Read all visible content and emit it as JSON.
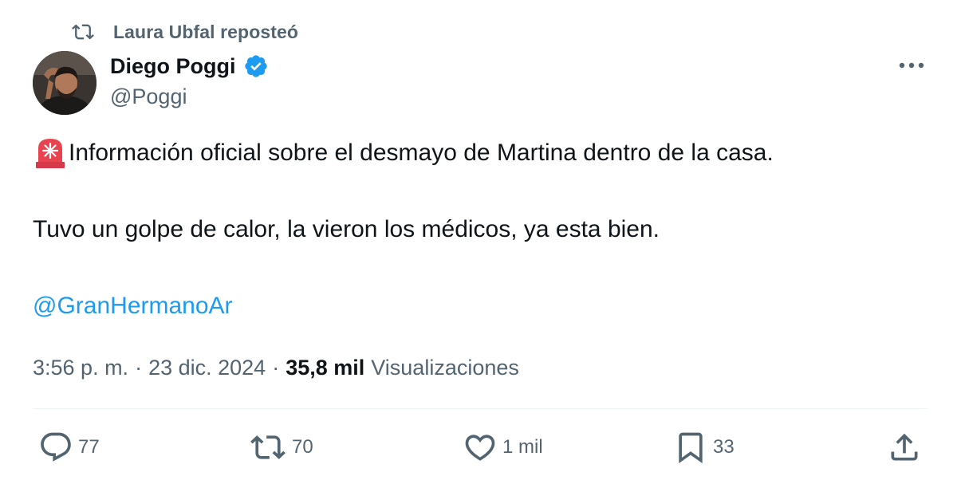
{
  "repost": {
    "icon": "repost-icon",
    "label": "Laura Ubfal reposteó"
  },
  "author": {
    "avatar_icon": "avatar",
    "name": "Diego Poggi",
    "verified_icon": "verified-badge-icon",
    "verified_color": "#1d9bf0",
    "handle": "@Poggi"
  },
  "menu": {
    "icon": "more-icon"
  },
  "tweet": {
    "emoji_icon": "rotating-light-icon",
    "line1": "Información oficial sobre el desmayo de Martina dentro de la casa.",
    "line2": "Tuvo un golpe de calor, la vieron los médicos, ya esta bien.",
    "mention": "@GranHermanoAr",
    "mention_color": "#1d9bf0"
  },
  "meta": {
    "time": "3:56 p. m.",
    "separator": "·",
    "date": "23 dic. 2024",
    "views_count": "35,8 mil",
    "views_label": "Visualizaciones"
  },
  "actions": {
    "reply": {
      "icon": "reply-icon",
      "count": "77"
    },
    "repost": {
      "icon": "repost-icon",
      "count": "70"
    },
    "like": {
      "icon": "heart-icon",
      "count": "1 mil"
    },
    "bookmark": {
      "icon": "bookmark-icon",
      "count": "33"
    },
    "share": {
      "icon": "share-icon"
    }
  },
  "colors": {
    "text_primary": "#0f1419",
    "text_secondary": "#536471",
    "accent": "#1d9bf0"
  }
}
